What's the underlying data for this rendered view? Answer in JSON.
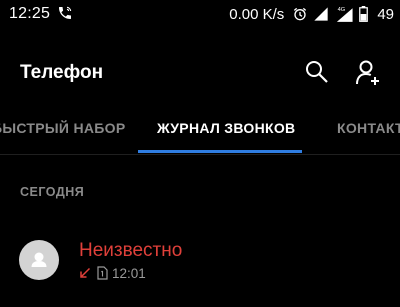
{
  "status_bar": {
    "time": "12:25",
    "network_speed": "0.00 K/s",
    "network_type": "4G",
    "battery": "49"
  },
  "app_bar": {
    "title": "Телефон",
    "search_icon": "search-icon",
    "add_contact_icon": "add-contact-icon"
  },
  "tabs": [
    {
      "label": "БЫСТРЫЙ НАБОР",
      "active": false
    },
    {
      "label": "ЖУРНАЛ ЗВОНКОВ",
      "active": true
    },
    {
      "label": "КОНТАКТЫ",
      "active": false
    }
  ],
  "call_log": {
    "section_header": "СЕГОДНЯ",
    "entries": [
      {
        "name": "Неизвестно",
        "call_type": "missed",
        "sim_icon": "sim-1-icon",
        "time": "12:01"
      }
    ]
  },
  "colors": {
    "background": "#000000",
    "accent": "#2f7de1",
    "missed_call": "#e0403a",
    "secondary_text": "#8a8a8a",
    "avatar_bg": "#d3d3d3"
  }
}
